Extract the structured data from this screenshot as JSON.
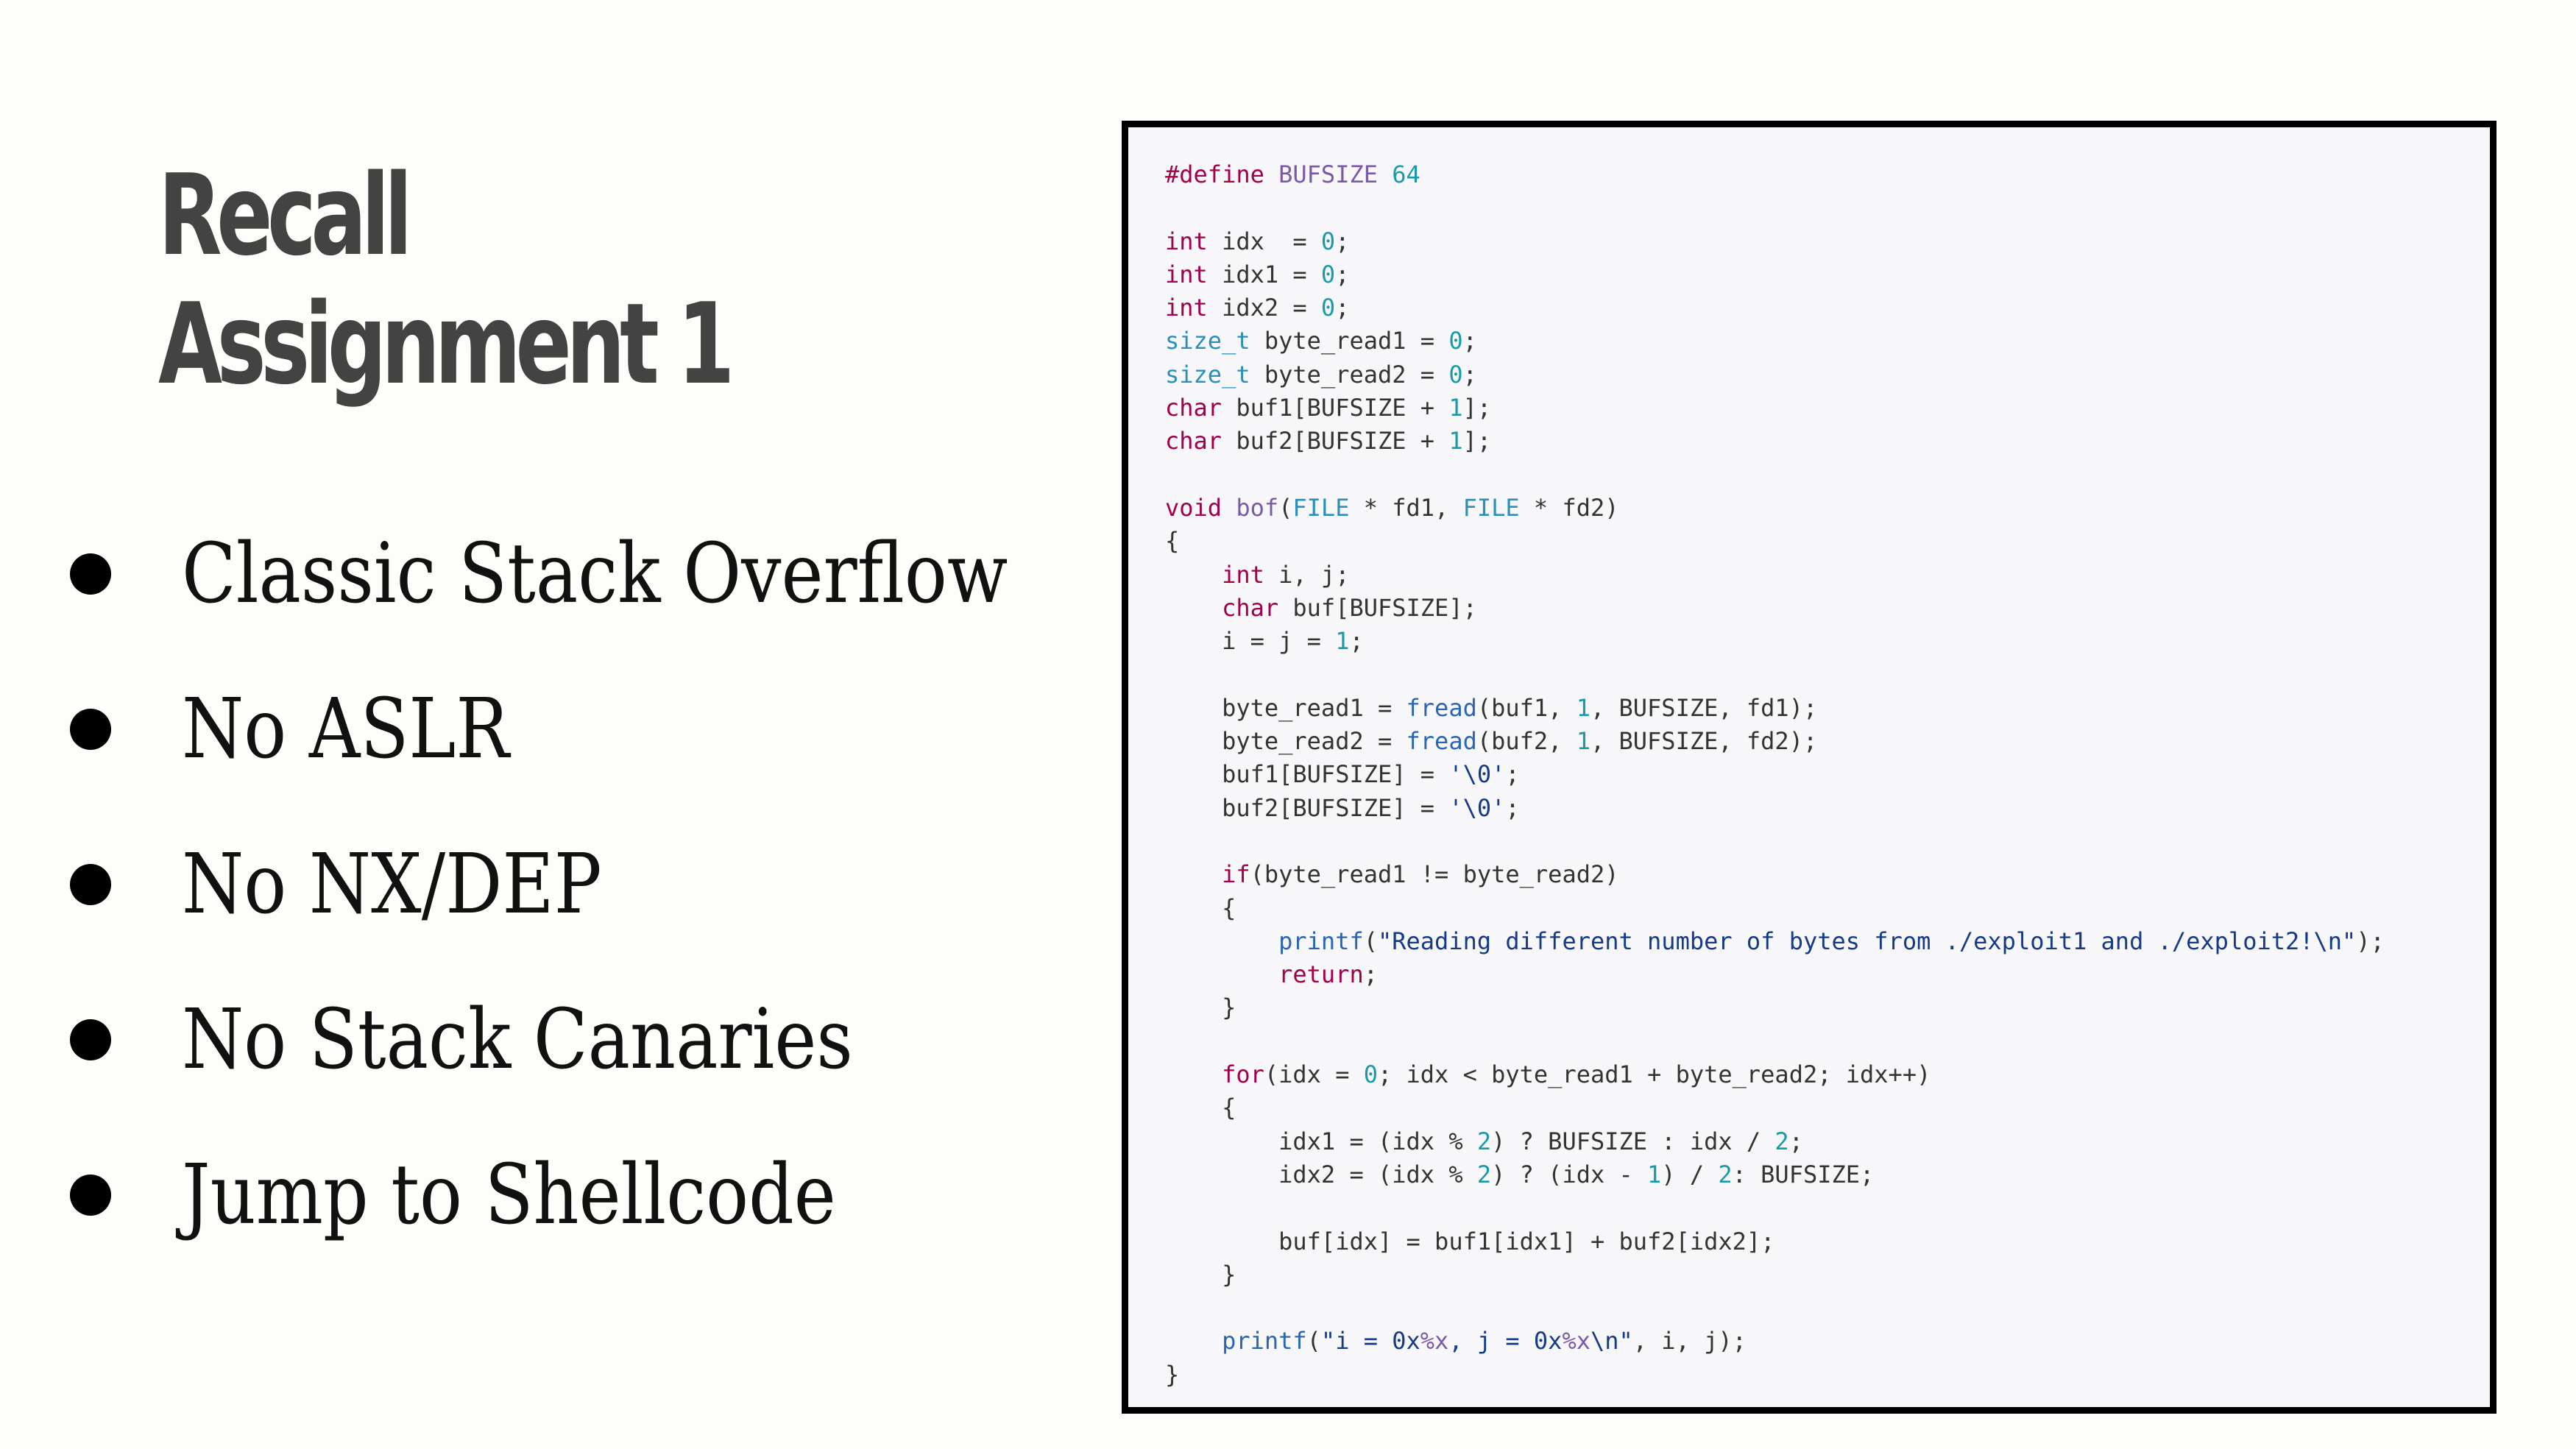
{
  "slide": {
    "title_lines": [
      "Recall",
      "Assignment 1"
    ],
    "bullets": [
      "Classic Stack Overflow",
      "No ASLR",
      "No NX/DEP",
      "No Stack Canaries",
      "Jump to Shellcode"
    ]
  },
  "code": {
    "language": "c",
    "lines": [
      [
        [
          "kw",
          "#define "
        ],
        [
          "mac",
          "BUFSIZE "
        ],
        [
          "num",
          "64"
        ]
      ],
      [],
      [
        [
          "kw",
          "int"
        ],
        [
          "pu",
          " idx  = "
        ],
        [
          "num",
          "0"
        ],
        [
          "pu",
          ";"
        ]
      ],
      [
        [
          "kw",
          "int"
        ],
        [
          "pu",
          " idx1 = "
        ],
        [
          "num",
          "0"
        ],
        [
          "pu",
          ";"
        ]
      ],
      [
        [
          "kw",
          "int"
        ],
        [
          "pu",
          " idx2 = "
        ],
        [
          "num",
          "0"
        ],
        [
          "pu",
          ";"
        ]
      ],
      [
        [
          "ty",
          "size_t"
        ],
        [
          "pu",
          " byte_read1 = "
        ],
        [
          "num",
          "0"
        ],
        [
          "pu",
          ";"
        ]
      ],
      [
        [
          "ty",
          "size_t"
        ],
        [
          "pu",
          " byte_read2 = "
        ],
        [
          "num",
          "0"
        ],
        [
          "pu",
          ";"
        ]
      ],
      [
        [
          "kw",
          "char"
        ],
        [
          "pu",
          " buf1[BUFSIZE + "
        ],
        [
          "num",
          "1"
        ],
        [
          "pu",
          "];"
        ]
      ],
      [
        [
          "kw",
          "char"
        ],
        [
          "pu",
          " buf2[BUFSIZE + "
        ],
        [
          "num",
          "1"
        ],
        [
          "pu",
          "];"
        ]
      ],
      [],
      [
        [
          "kw",
          "void"
        ],
        [
          "pu",
          " "
        ],
        [
          "mac",
          "bof"
        ],
        [
          "pu",
          "("
        ],
        [
          "ty",
          "FILE"
        ],
        [
          "pu",
          " * fd1, "
        ],
        [
          "ty",
          "FILE"
        ],
        [
          "pu",
          " * fd2)"
        ]
      ],
      [
        [
          "pu",
          "{"
        ]
      ],
      [
        [
          "pu",
          "    "
        ],
        [
          "kw",
          "int"
        ],
        [
          "pu",
          " i, j;"
        ]
      ],
      [
        [
          "pu",
          "    "
        ],
        [
          "kw",
          "char"
        ],
        [
          "pu",
          " buf[BUFSIZE];"
        ]
      ],
      [
        [
          "pu",
          "    i = j = "
        ],
        [
          "num",
          "1"
        ],
        [
          "pu",
          ";"
        ]
      ],
      [],
      [
        [
          "pu",
          "    byte_read1 = "
        ],
        [
          "fn",
          "fread"
        ],
        [
          "pu",
          "(buf1, "
        ],
        [
          "num",
          "1"
        ],
        [
          "pu",
          ", BUFSIZE, fd1);"
        ]
      ],
      [
        [
          "pu",
          "    byte_read2 = "
        ],
        [
          "fn",
          "fread"
        ],
        [
          "pu",
          "(buf2, "
        ],
        [
          "num",
          "1"
        ],
        [
          "pu",
          ", BUFSIZE, fd2);"
        ]
      ],
      [
        [
          "pu",
          "    buf1[BUFSIZE] = "
        ],
        [
          "str",
          "'\\0'"
        ],
        [
          "pu",
          ";"
        ]
      ],
      [
        [
          "pu",
          "    buf2[BUFSIZE] = "
        ],
        [
          "str",
          "'\\0'"
        ],
        [
          "pu",
          ";"
        ]
      ],
      [],
      [
        [
          "pu",
          "    "
        ],
        [
          "kw",
          "if"
        ],
        [
          "pu",
          "(byte_read1 != byte_read2)"
        ]
      ],
      [
        [
          "pu",
          "    {"
        ]
      ],
      [
        [
          "pu",
          "        "
        ],
        [
          "fn",
          "printf"
        ],
        [
          "pu",
          "("
        ],
        [
          "str",
          "\"Reading different number of bytes from ./exploit1 and ./exploit2!\\n\""
        ],
        [
          "pu",
          ");"
        ]
      ],
      [
        [
          "pu",
          "        "
        ],
        [
          "kw",
          "return"
        ],
        [
          "pu",
          ";"
        ]
      ],
      [
        [
          "pu",
          "    }"
        ]
      ],
      [],
      [
        [
          "pu",
          "    "
        ],
        [
          "kw",
          "for"
        ],
        [
          "pu",
          "(idx = "
        ],
        [
          "num",
          "0"
        ],
        [
          "pu",
          "; idx < byte_read1 + byte_read2; idx++)"
        ]
      ],
      [
        [
          "pu",
          "    {"
        ]
      ],
      [
        [
          "pu",
          "        idx1 = (idx % "
        ],
        [
          "num",
          "2"
        ],
        [
          "pu",
          ") ? BUFSIZE : idx / "
        ],
        [
          "num",
          "2"
        ],
        [
          "pu",
          ";"
        ]
      ],
      [
        [
          "pu",
          "        idx2 = (idx % "
        ],
        [
          "num",
          "2"
        ],
        [
          "pu",
          ") ? (idx - "
        ],
        [
          "num",
          "1"
        ],
        [
          "pu",
          ") / "
        ],
        [
          "num",
          "2"
        ],
        [
          "pu",
          ": BUFSIZE;"
        ]
      ],
      [],
      [
        [
          "pu",
          "        buf[idx] = buf1[idx1] + buf2[idx2];"
        ]
      ],
      [
        [
          "pu",
          "    }"
        ]
      ],
      [],
      [
        [
          "pu",
          "    "
        ],
        [
          "fn",
          "printf"
        ],
        [
          "pu",
          "("
        ],
        [
          "str",
          "\"i = 0x"
        ],
        [
          "mac",
          "%x"
        ],
        [
          "str",
          ", j = 0x"
        ],
        [
          "mac",
          "%x"
        ],
        [
          "str",
          "\\n\""
        ],
        [
          "pu",
          ", i, j);"
        ]
      ],
      [
        [
          "pu",
          "}"
        ]
      ]
    ]
  },
  "colors": {
    "background": "#fdfdfa",
    "title": "#434343",
    "code_background": "#f7f7f9",
    "code_border": "#000000",
    "keyword": "#a0004c",
    "type": "#2b8fb8",
    "number": "#1a9aa8",
    "function": "#2a66b5",
    "string": "#143a88",
    "macro": "#7a5aa6"
  }
}
